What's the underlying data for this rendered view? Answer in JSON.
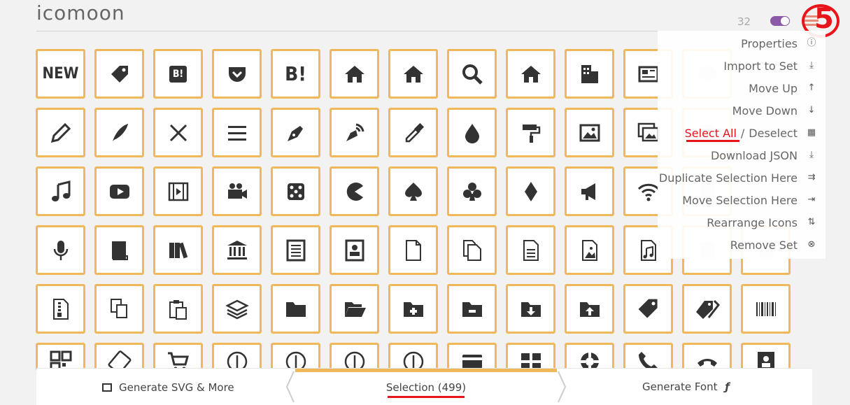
{
  "app": {
    "title": "icomoon"
  },
  "header": {
    "count": "32"
  },
  "annotation": {
    "step": "5"
  },
  "menu": {
    "items": [
      {
        "label": "Properties",
        "icon": "info-icon"
      },
      {
        "label": "Import to Set",
        "icon": "import-icon"
      },
      {
        "label": "Move Up",
        "icon": "move-up-icon"
      },
      {
        "label": "Move Down",
        "icon": "move-down-icon"
      },
      {
        "label": "Select All",
        "sep": "/",
        "label2": "Deselect",
        "icon": "select-all-icon"
      },
      {
        "label": "Download JSON",
        "icon": "download-icon"
      },
      {
        "label": "Duplicate Selection Here",
        "icon": "duplicate-icon"
      },
      {
        "label": "Move Selection Here",
        "icon": "move-selection-icon"
      },
      {
        "label": "Rearrange Icons",
        "icon": "rearrange-icon"
      },
      {
        "label": "Remove Set",
        "icon": "remove-icon"
      }
    ]
  },
  "icons": {
    "row1": [
      "NEW",
      "B!",
      "B!"
    ]
  },
  "bottom": {
    "generate_svg": "Generate SVG & More",
    "selection": "Selection (499)",
    "generate_font": "Generate Font",
    "font_symbol": "ƒ"
  },
  "colors": {
    "accent": "#f1b85a",
    "annotation": "#e8141a",
    "toggle": "#8a5aa8"
  }
}
